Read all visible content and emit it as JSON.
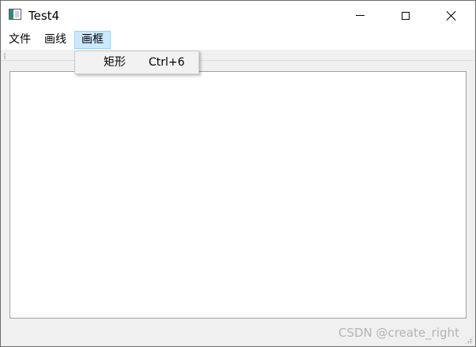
{
  "window": {
    "title": "Test4",
    "icon": "app-window-icon"
  },
  "menubar": {
    "items": [
      {
        "label": "文件"
      },
      {
        "label": "画线"
      },
      {
        "label": "画框",
        "active": true
      }
    ]
  },
  "dropdown": {
    "items": [
      {
        "label": "矩形",
        "shortcut": "Ctrl+6"
      }
    ]
  },
  "watermark": "CSDN @create_right",
  "colors": {
    "active_menu_bg": "#cce8ff",
    "active_menu_border": "#99d1ff",
    "window_bg": "#f0f0f0",
    "watermark": "#b4b4b4"
  }
}
